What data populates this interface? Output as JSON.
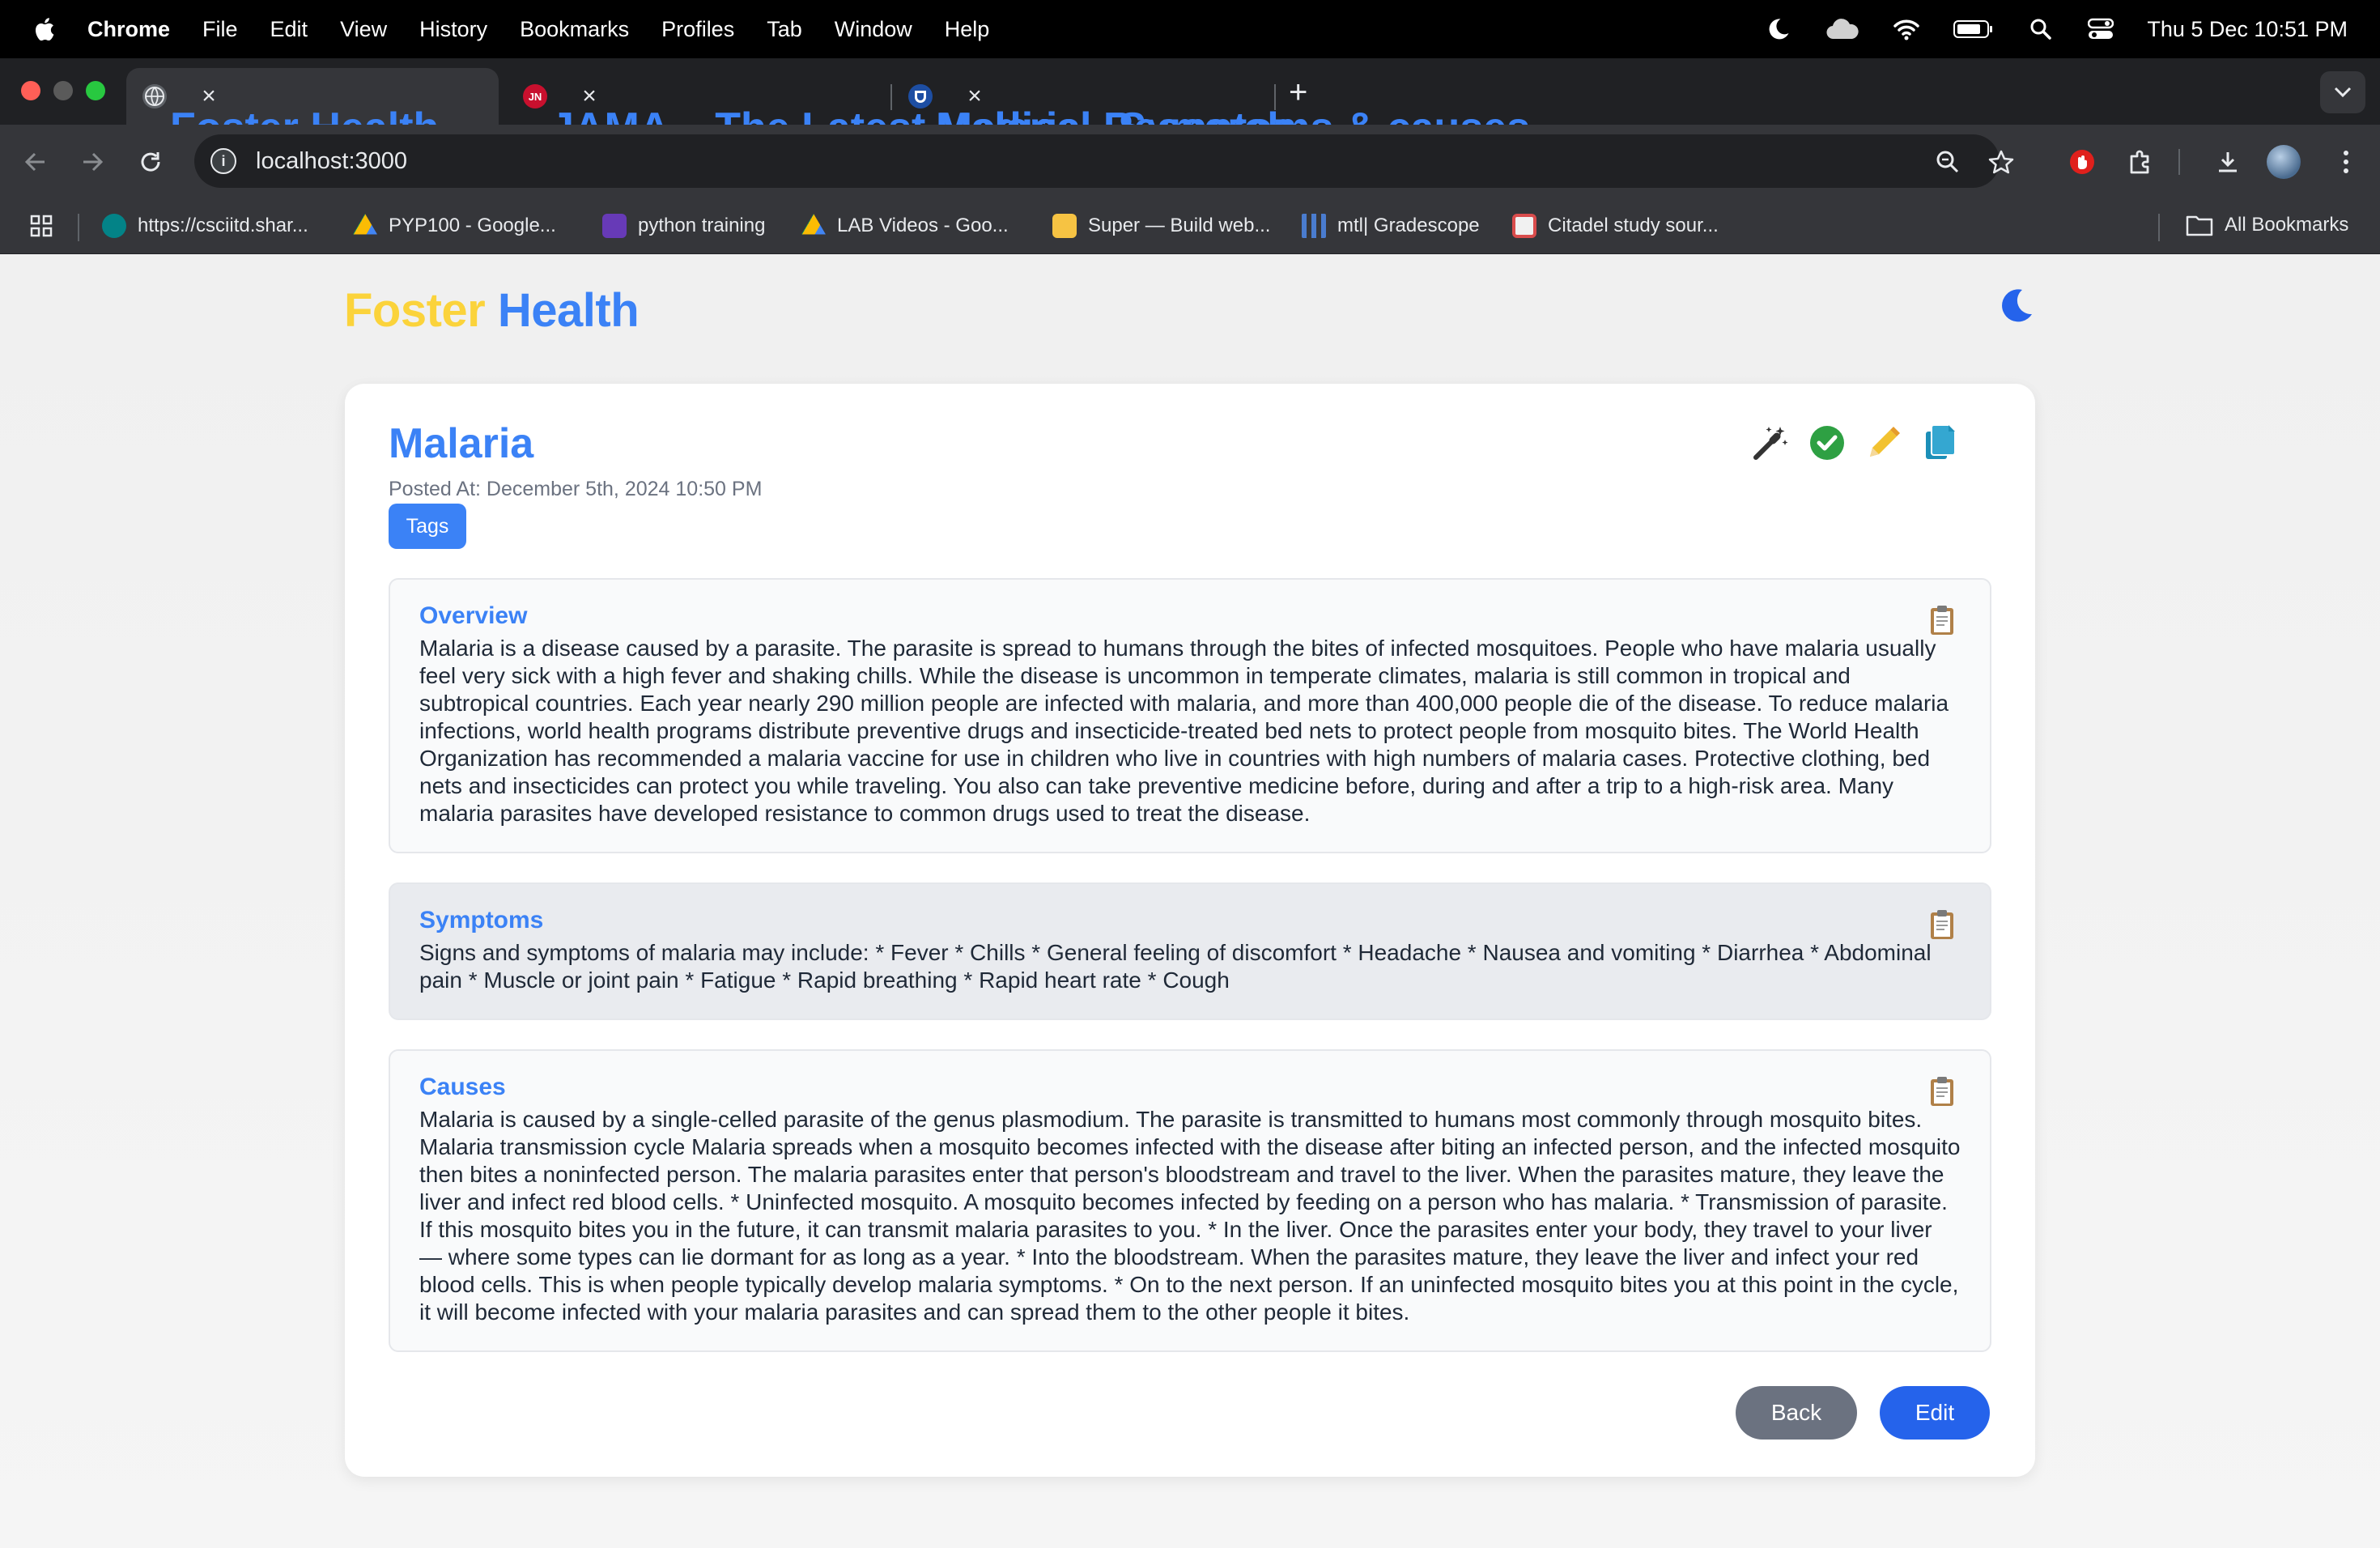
{
  "menubar": {
    "app": "Chrome",
    "items": [
      "File",
      "Edit",
      "View",
      "History",
      "Bookmarks",
      "Profiles",
      "Tab",
      "Window",
      "Help"
    ],
    "clock": "Thu 5 Dec  10:51 PM"
  },
  "tabs": [
    {
      "title": "Foster Health",
      "favicon": "globe-icon",
      "active": true
    },
    {
      "title": "JAMA – The Latest Medical Research",
      "favicon": "JN",
      "active": false
    },
    {
      "title": "Malaria - Symptoms & causes",
      "favicon": "mayo-icon",
      "active": false
    }
  ],
  "address": {
    "url": "localhost:3000"
  },
  "bookmarks": [
    {
      "label": "https://csciitd.shar...",
      "icon": "sharepoint-icon"
    },
    {
      "label": "PYP100 - Google...",
      "icon": "drive-icon"
    },
    {
      "label": "python training",
      "icon": "forms-icon"
    },
    {
      "label": "LAB Videos - Goo...",
      "icon": "drive-icon"
    },
    {
      "label": "Super — Build web...",
      "icon": "super-icon"
    },
    {
      "label": "mtl| Gradescope",
      "icon": "gradescope-icon"
    },
    {
      "label": "Citadel study sour...",
      "icon": "citadel-icon"
    }
  ],
  "bookmarks_all": "All Bookmarks",
  "brand": {
    "first": "Foster",
    "second": "Health"
  },
  "colors": {
    "brand_yellow": "#fbd33b",
    "brand_blue": "#3b82f6",
    "edit_blue": "#2563eb",
    "back_gray": "#6b7280"
  },
  "post": {
    "title": "Malaria",
    "posted_at": "Posted At: December 5th, 2024 10:50 PM",
    "tags_label": "Tags",
    "sections": [
      {
        "heading": "Overview",
        "body": "Malaria is a disease caused by a parasite. The parasite is spread to humans through the bites of infected mosquitoes. People who have malaria usually feel very sick with a high fever and shaking chills. While the disease is uncommon in temperate climates, malaria is still common in tropical and subtropical countries. Each year nearly 290 million people are infected with malaria, and more than 400,000 people die of the disease. To reduce malaria infections, world health programs distribute preventive drugs and insecticide-treated bed nets to protect people from mosquito bites. The World Health Organization has recommended a malaria vaccine for use in children who live in countries with high numbers of malaria cases. Protective clothing, bed nets and insecticides can protect you while traveling. You also can take preventive medicine before, during and after a trip to a high-risk area. Many malaria parasites have developed resistance to common drugs used to treat the disease."
      },
      {
        "heading": "Symptoms",
        "body": "Signs and symptoms of malaria may include: * Fever * Chills * General feeling of discomfort * Headache * Nausea and vomiting * Diarrhea * Abdominal pain * Muscle or joint pain * Fatigue * Rapid breathing * Rapid heart rate * Cough"
      },
      {
        "heading": "Causes",
        "body": "Malaria is caused by a single-celled parasite of the genus plasmodium. The parasite is transmitted to humans most commonly through mosquito bites. Malaria transmission cycle Malaria spreads when a mosquito becomes infected with the disease after biting an infected person, and the infected mosquito then bites a noninfected person. The malaria parasites enter that person's bloodstream and travel to the liver. When the parasites mature, they leave the liver and infect red blood cells. * Uninfected mosquito. A mosquito becomes infected by feeding on a person who has malaria. * Transmission of parasite. If this mosquito bites you in the future, it can transmit malaria parasites to you. * In the liver. Once the parasites enter your body, they travel to your liver — where some types can lie dormant for as long as a year. * Into the bloodstream. When the parasites mature, they leave the liver and infect your red blood cells. This is when people typically develop malaria symptoms. * On to the next person. If an uninfected mosquito bites you at this point in the cycle, it will become infected with your malaria parasites and can spread them to the other people it bites."
      }
    ],
    "back_label": "Back",
    "edit_label": "Edit"
  }
}
